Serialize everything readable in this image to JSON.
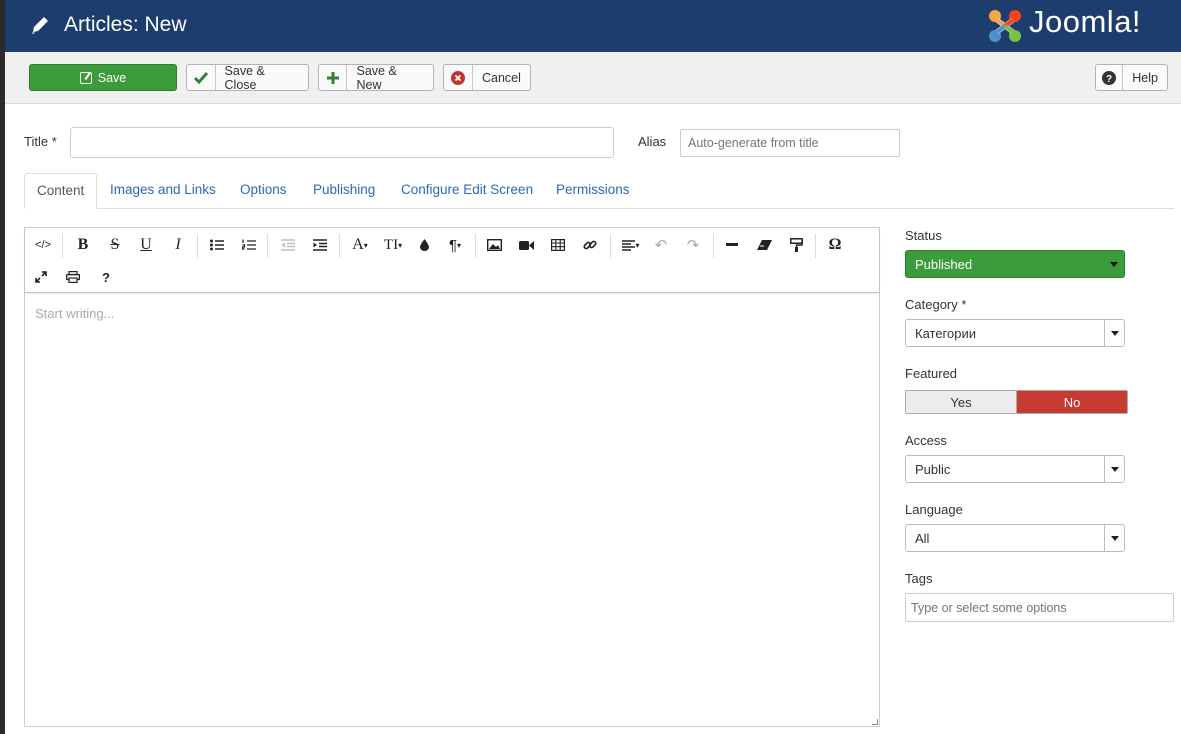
{
  "header": {
    "title": "Articles: New",
    "logo_text": "Joomla!",
    "bg_color": "#1c3d6e"
  },
  "toolbar": {
    "save": "Save",
    "save_close": "Save & Close",
    "save_new": "Save & New",
    "cancel": "Cancel",
    "help": "Help"
  },
  "form": {
    "title_label": "Title *",
    "title_value": "",
    "alias_label": "Alias",
    "alias_placeholder": "Auto-generate from title"
  },
  "tabs": [
    {
      "label": "Content",
      "active": true
    },
    {
      "label": "Images and Links"
    },
    {
      "label": "Options"
    },
    {
      "label": "Publishing"
    },
    {
      "label": "Configure Edit Screen"
    },
    {
      "label": "Permissions"
    }
  ],
  "editor": {
    "placeholder": "Start writing...",
    "buttons": [
      "code-icon",
      "bold-icon",
      "strikethrough-icon",
      "underline-icon",
      "italic-icon",
      "bullet-list-icon",
      "numbered-list-icon",
      "outdent-icon",
      "indent-icon",
      "font-color-icon",
      "font-size-icon",
      "text-color-drop-icon",
      "paragraph-icon",
      "image-icon",
      "video-icon",
      "table-icon",
      "link-icon",
      "align-icon",
      "undo-icon",
      "redo-icon",
      "horizontal-rule-icon",
      "eraser-icon",
      "format-painter-icon",
      "omega-icon",
      "fullscreen-icon",
      "print-icon",
      "help-icon"
    ]
  },
  "sidebar": {
    "status_label": "Status",
    "status_value": "Published",
    "category_label": "Category *",
    "category_value": "Категории",
    "featured_label": "Featured",
    "featured_yes": "Yes",
    "featured_no": "No",
    "access_label": "Access",
    "access_value": "Public",
    "language_label": "Language",
    "language_value": "All",
    "tags_label": "Tags",
    "tags_placeholder": "Type or select some options"
  },
  "colors": {
    "save_green": "#3c9c3c",
    "featured_no_red": "#c53a33",
    "link_blue": "#2a69b8"
  }
}
